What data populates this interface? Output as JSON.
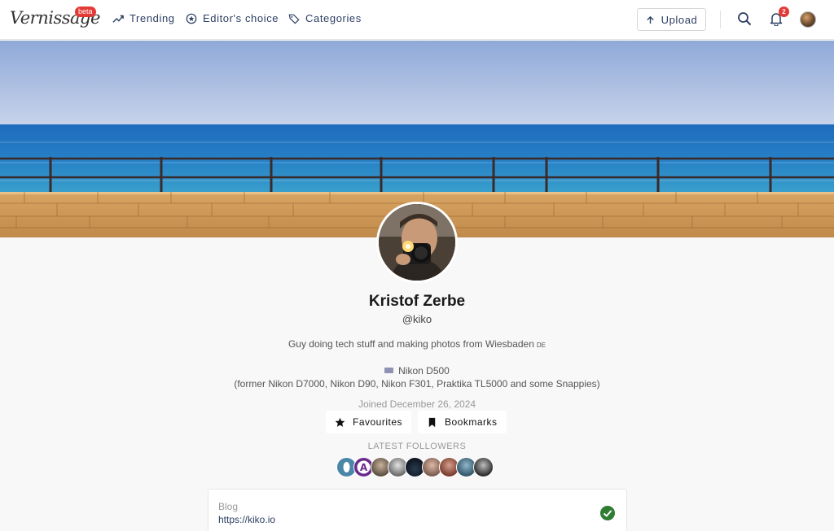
{
  "brand": {
    "logo_text": "Vernissage",
    "beta_label": "beta"
  },
  "nav": {
    "trending": "Trending",
    "editors_choice": "Editor's choice",
    "categories": "Categories",
    "upload": "Upload",
    "notification_count": "2"
  },
  "profile": {
    "name": "Kristof Zerbe",
    "handle": "@kiko",
    "bio": "Guy doing tech stuff and making photos from Wiesbaden",
    "bio_flag": "DE",
    "camera": "Nikon D500",
    "camera_former": "(former Nikon D7000, Nikon D90, Nikon F301, Praktika TL5000 and some Snappies)",
    "joined": "Joined December 26, 2024"
  },
  "actions": {
    "favourites": "Favourites",
    "bookmarks": "Bookmarks"
  },
  "followers": {
    "label": "LATEST FOLLOWERS",
    "count_shown": 9
  },
  "fields": [
    {
      "label": "Blog",
      "value": "https://kiko.io",
      "verified": true
    }
  ],
  "colors": {
    "accent": "#2c3e63",
    "badge": "#e53935",
    "verified": "#2e7d32",
    "background": "#f8f8f8"
  }
}
